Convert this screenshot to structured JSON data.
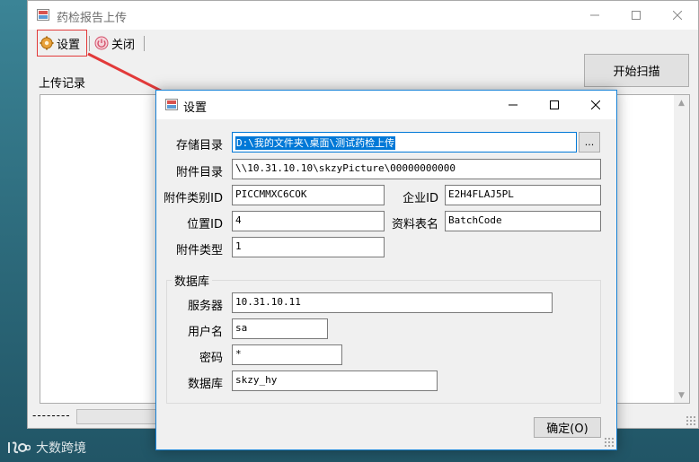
{
  "main_window": {
    "title": "药检报告上传",
    "toolbar": {
      "settings_label": "设置",
      "close_label": "关闭"
    },
    "start_scan_label": "开始扫描",
    "upload_record_label": "上传记录",
    "status_text": "--------"
  },
  "dialog": {
    "title": "设置",
    "fields": {
      "storage_dir": {
        "label": "存储目录",
        "value": "D:\\我的文件夹\\桌面\\测试药检上传"
      },
      "attachment_dir": {
        "label": "附件目录",
        "value": "\\\\10.31.10.10\\skzyPicture\\00000000000"
      },
      "attachment_category_id": {
        "label": "附件类别ID",
        "value": "PICCMMXC6COK"
      },
      "enterprise_id": {
        "label": "企业ID",
        "value": "E2H4FLAJ5PL"
      },
      "position_id": {
        "label": "位置ID",
        "value": "4"
      },
      "data_table_name": {
        "label": "资料表名",
        "value": "BatchCode"
      },
      "attachment_type": {
        "label": "附件类型",
        "value": "1"
      }
    },
    "browse_label": "...",
    "database_group": {
      "label": "数据库",
      "server": {
        "label": "服务器",
        "value": "10.31.10.11"
      },
      "username": {
        "label": "用户名",
        "value": "sa"
      },
      "password": {
        "label": "密码",
        "value": "*"
      },
      "database": {
        "label": "数据库",
        "value": "skzy_hy"
      }
    },
    "ok_label": "确定(O)"
  },
  "watermark_text": "大数跨境",
  "colors": {
    "accent": "#0078d7",
    "annotation": "#e23a3a",
    "window_bg": "#f0f0f0"
  }
}
